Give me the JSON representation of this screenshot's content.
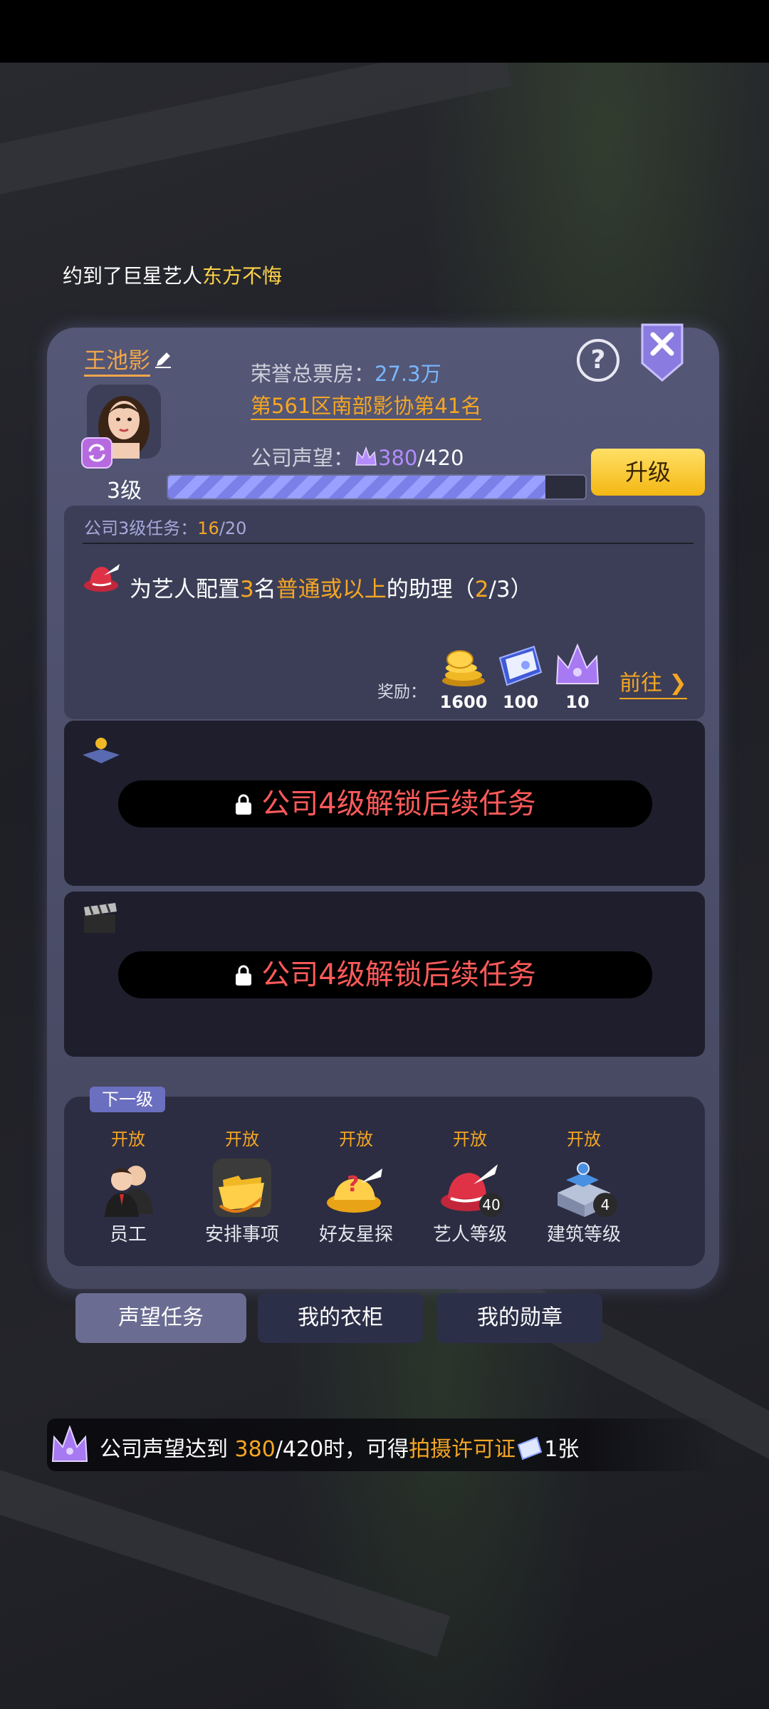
{
  "ticker": {
    "prefix": "约到了巨星艺人",
    "highlight": "东方不悔"
  },
  "profile": {
    "name": "王池影",
    "level": "3级",
    "honor_label": "荣誉总票房：",
    "honor_value": "27.3万",
    "rank": "第561区南部影协第41名",
    "prestige_label": "公司声望：",
    "prestige_current": "380",
    "prestige_max": "/420",
    "prestige_progress": 0.905,
    "upgrade_label": "升级"
  },
  "task": {
    "header_label": "公司3级任务：",
    "header_count": "16",
    "header_total": "/20",
    "text_a": "为艺人配置",
    "text_num": "3",
    "text_b": "名",
    "text_hl": "普通或以上",
    "text_c": "的助理（",
    "progress_cur": "2",
    "progress_rest": "/3）",
    "reward_label": "奖励：",
    "rewards": [
      {
        "icon": "gold-coins-icon",
        "value": "1600"
      },
      {
        "icon": "permit-document-icon",
        "value": "100"
      },
      {
        "icon": "prestige-crown-icon",
        "value": "10"
      }
    ],
    "goto_label": "前往"
  },
  "locked": [
    {
      "icon": "map-pin-icon",
      "text": "公司4级解锁后续任务"
    },
    {
      "icon": "clapperboard-icon",
      "text": "公司4级解锁后续任务"
    }
  ],
  "next_level": {
    "tag": "下一级",
    "features": [
      {
        "status": "开放",
        "label": "员工",
        "icon": "staff-icon"
      },
      {
        "status": "开放",
        "label": "安排事项",
        "icon": "schedule-folder-icon"
      },
      {
        "status": "开放",
        "label": "好友星探",
        "icon": "talent-scout-icon"
      },
      {
        "status": "开放",
        "label": "艺人等级",
        "icon": "artist-hat-icon",
        "badge": "40"
      },
      {
        "status": "开放",
        "label": "建筑等级",
        "icon": "building-icon",
        "badge": "4"
      }
    ]
  },
  "tabs": [
    {
      "label": "声望任务",
      "active": true
    },
    {
      "label": "我的衣柜",
      "active": false
    },
    {
      "label": "我的勋章",
      "active": false
    }
  ],
  "info": {
    "a": "公司声望达到 ",
    "cur": "380",
    "b": "/420时，可得",
    "hl": "拍摄许可证",
    "c": "1张"
  }
}
